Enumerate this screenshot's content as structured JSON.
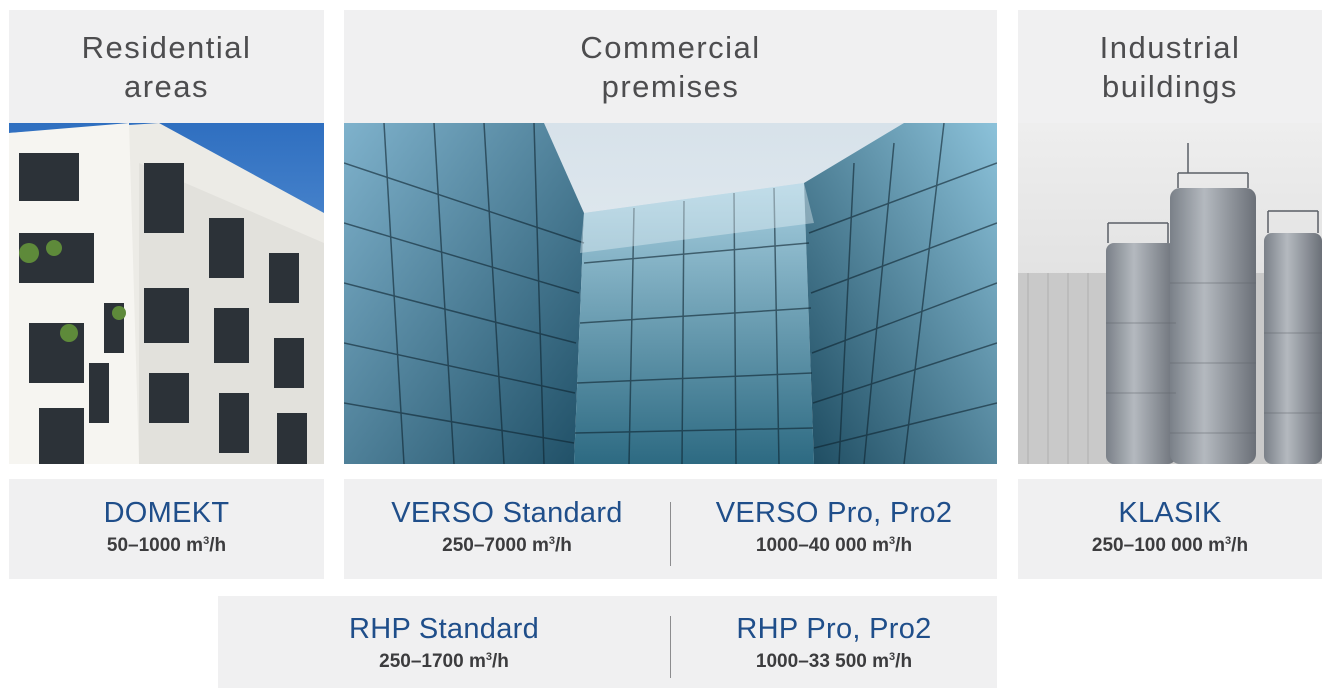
{
  "categories": [
    {
      "line1": "Residential",
      "line2": "areas"
    },
    {
      "line1": "Commercial",
      "line2": "premises"
    },
    {
      "line1": "Industrial",
      "line2": "buildings"
    }
  ],
  "products": {
    "domekt": {
      "name": "DOMEKT",
      "flow": "50–1000 m",
      "unit": "/h"
    },
    "verso_standard": {
      "name": "VERSO Standard",
      "flow": "250–7000 m",
      "unit": "/h"
    },
    "verso_pro": {
      "name": "VERSO Pro, Pro2",
      "flow": "1000–40 000 m",
      "unit": "/h"
    },
    "klasik": {
      "name": "KLASIK",
      "flow": "250–100 000 m",
      "unit": "/h"
    },
    "rhp_standard": {
      "name": "RHP Standard",
      "flow": "250–1700 m",
      "unit": "/h"
    },
    "rhp_pro": {
      "name": "RHP Pro, Pro2",
      "flow": "1000–33 500 m",
      "unit": "/h"
    }
  },
  "superscript": "3",
  "colors": {
    "panel_bg": "#f0f0f1",
    "title_text": "#4d4d4f",
    "product_name": "#1f4e8a",
    "flow_text": "#3c3c3e"
  }
}
